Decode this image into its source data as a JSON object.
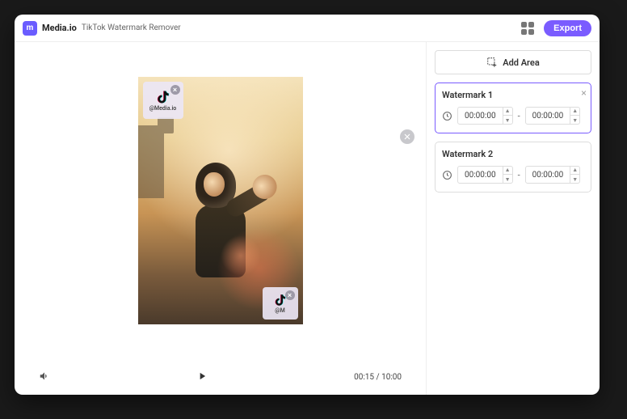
{
  "header": {
    "brand": "Media.io",
    "subtitle": "TikTok Watermark Remover",
    "export_label": "Export"
  },
  "preview": {
    "watermarks": [
      {
        "label": "@Media.io"
      },
      {
        "label": "@M"
      }
    ],
    "time_current": "00:15",
    "time_total": "10:00"
  },
  "sidebar": {
    "add_area_label": "Add Area",
    "cards": [
      {
        "title": "Watermark 1",
        "active": true,
        "start": "00:00:00",
        "end": "00:00:00"
      },
      {
        "title": "Watermark 2",
        "active": false,
        "start": "00:00:00",
        "end": "00:00:00"
      }
    ]
  }
}
